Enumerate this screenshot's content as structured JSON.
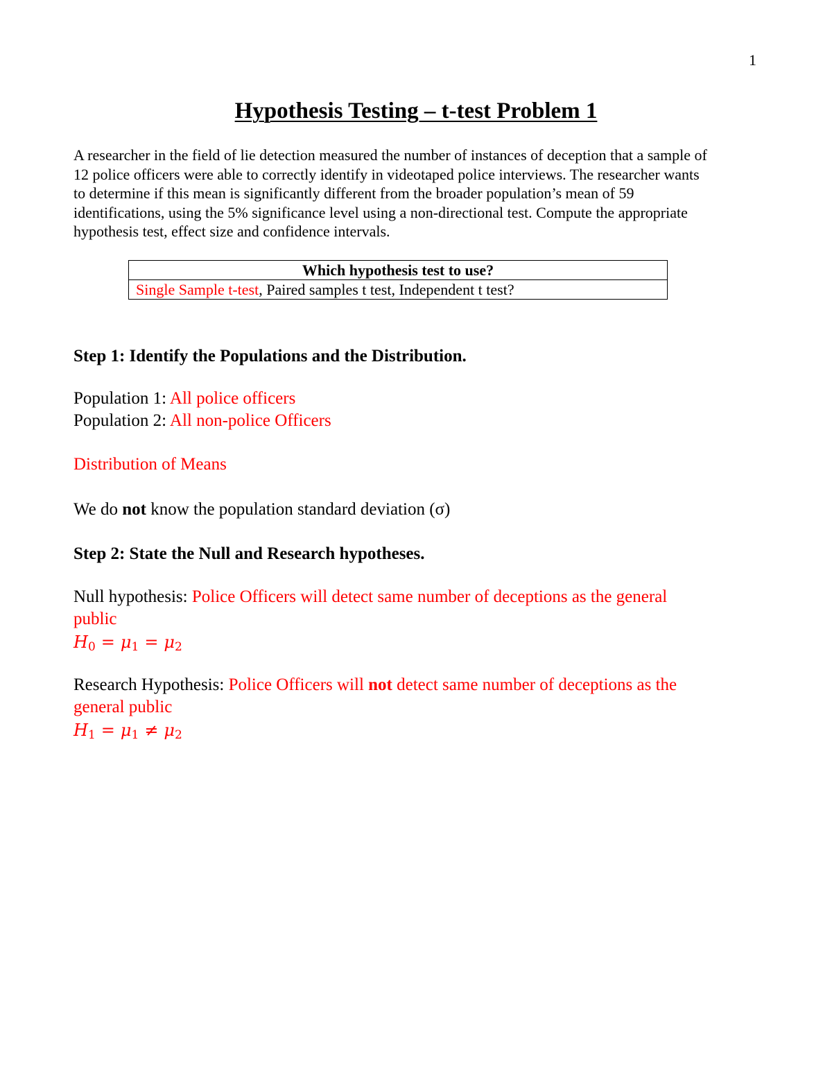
{
  "page_number": "1",
  "title": "Hypothesis Testing – t-test Problem 1",
  "intro_lines": [
    "A researcher in the field of lie detection measured the number of instances of deception that a sample of",
    "12 police officers were able to correctly identify in videotaped police interviews. The researcher wants",
    "to determine if this mean is significantly different from the broader population’s mean of 59",
    "identifications, using the 5% significance level using a non-directional test. Compute the appropriate",
    "hypothesis test, effect size and confidence intervals."
  ],
  "test_table": {
    "header": "Which hypothesis test to use?",
    "selected_option": "Single Sample t-test",
    "other_options": ",  Paired samples t test, Independent t test?"
  },
  "step1": {
    "heading": "Step 1: Identify the Populations and the Distribution.",
    "population1_label": "Population 1: ",
    "population1_value": "All police officers",
    "population2_label": "Population 2: ",
    "population2_value": "All non-police Officers",
    "distribution": "Distribution of Means",
    "sigma_prefix": "We do ",
    "sigma_bold": "not",
    "sigma_suffix": " know the population standard deviation (σ)"
  },
  "step2": {
    "heading": "Step 2: State the Null and Research hypotheses.",
    "null_label": "Null hypothesis: ",
    "null_text_line1": "Police Officers will detect same number of deceptions as the general",
    "null_text_line2": "public",
    "null_formula": {
      "lhs": "H",
      "lhs_sub": "0",
      "op1": "=",
      "mid": "μ",
      "mid_sub": "1",
      "op2": "=",
      "rhs": "μ",
      "rhs_sub": "2"
    },
    "research_label": "Research Hypothesis: ",
    "research_text_pre": "Police Officers will ",
    "research_text_bold": "not",
    "research_text_post": " detect same number of deceptions as the",
    "research_text_line2": "general public",
    "research_formula": {
      "lhs": "H",
      "lhs_sub": "1",
      "op1": "=",
      "mid": "μ",
      "mid_sub": "1",
      "op2": "≠",
      "rhs": "μ",
      "rhs_sub": "2"
    }
  }
}
